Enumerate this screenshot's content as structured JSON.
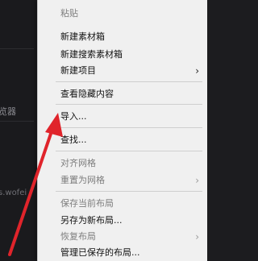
{
  "background": {
    "fragments": [
      "览器",
      "s.wofei"
    ]
  },
  "menu": {
    "items": [
      {
        "label": "粘贴",
        "disabled": true
      },
      {
        "label": "新建素材箱",
        "disabled": false
      },
      {
        "label": "新建搜索素材箱",
        "disabled": false
      },
      {
        "label": "新建项目",
        "disabled": false,
        "submenu": true
      },
      {
        "label": "查看隐藏内容",
        "disabled": false
      },
      {
        "label": "导入...",
        "disabled": false
      },
      {
        "label": "查找...",
        "disabled": false
      },
      {
        "label": "对齐网格",
        "disabled": true
      },
      {
        "label": "重置为网格",
        "disabled": true,
        "submenu": true
      },
      {
        "label": "保存当前布局",
        "disabled": true
      },
      {
        "label": "另存为新布局...",
        "disabled": false
      },
      {
        "label": "恢复布局",
        "disabled": true,
        "submenu": true
      },
      {
        "label": "管理已保存的布局...",
        "disabled": false
      }
    ],
    "submenu_glyph": "›"
  },
  "colors": {
    "annotation_arrow": "#e0242b",
    "menu_bg": "#f0f0f0",
    "disabled_text": "#7d7d7d"
  }
}
